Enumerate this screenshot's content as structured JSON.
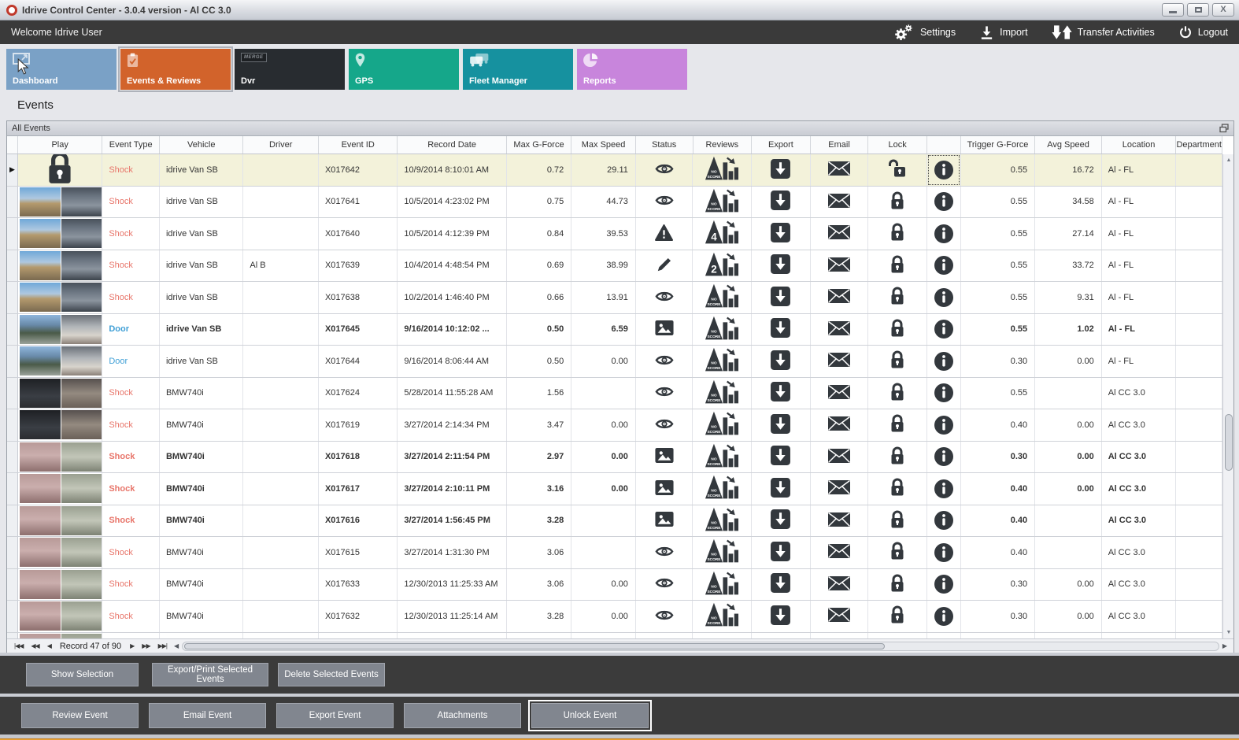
{
  "window": {
    "title": "Idrive Control Center - 3.0.4 version - Al CC 3.0",
    "controls": {
      "minimize": "minimize",
      "maximize": "maximize",
      "close": "close"
    }
  },
  "toolbar": {
    "welcome": "Welcome Idrive User",
    "settings_label": "Settings",
    "import_label": "Import",
    "transfer_label": "Transfer Activities",
    "logout_label": "Logout"
  },
  "nav_tiles": [
    {
      "label": "Dashboard",
      "color": "#7aa1c6",
      "icon": "monitor-icon",
      "selected": false
    },
    {
      "label": "Events & Reviews",
      "color": "#d2632b",
      "icon": "clipboard-check-icon",
      "selected": true
    },
    {
      "label": "Dvr",
      "color": "#282c30",
      "icon": "merge-badge-icon",
      "selected": false
    },
    {
      "label": "GPS",
      "color": "#15a78a",
      "icon": "location-pin-icon",
      "selected": false
    },
    {
      "label": "Fleet Manager",
      "color": "#16919f",
      "icon": "vehicles-icon",
      "selected": false
    },
    {
      "label": "Reports",
      "color": "#c885dc",
      "icon": "pie-chart-icon",
      "selected": false
    }
  ],
  "page": {
    "heading": "Events",
    "group_title": "All Events"
  },
  "table": {
    "columns": [
      "",
      "Play",
      "Event Type",
      "Vehicle",
      "Driver",
      "Event ID",
      "Record Date",
      "Max G-Force",
      "Max Speed",
      "Status",
      "Reviews",
      "Export",
      "Email",
      "Lock",
      "",
      "Trigger G-Force",
      "Avg Speed",
      "Location",
      "Department"
    ],
    "rows": [
      {
        "selected": true,
        "bold": false,
        "partial": false,
        "thumb": "lock",
        "event_type": "Shock",
        "vehicle": "idrive Van SB",
        "driver": "",
        "event_id": "X017642",
        "record_date": "10/9/2014 8:10:01 AM",
        "max_g": "0.72",
        "max_speed": "29.11",
        "status": "eye",
        "review": "NO SCORE",
        "lock": "unlocked",
        "trigger_g": "0.55",
        "avg_speed": "16.72",
        "location": "Al - FL",
        "department": ""
      },
      {
        "selected": false,
        "bold": false,
        "partial": false,
        "thumb": "van",
        "event_type": "Shock",
        "vehicle": "idrive Van SB",
        "driver": "",
        "event_id": "X017641",
        "record_date": "10/5/2014 4:23:02 PM",
        "max_g": "0.75",
        "max_speed": "44.73",
        "status": "eye",
        "review": "NO SCORE",
        "lock": "locked",
        "trigger_g": "0.55",
        "avg_speed": "34.58",
        "location": "Al - FL",
        "department": ""
      },
      {
        "selected": false,
        "bold": false,
        "partial": false,
        "thumb": "van",
        "event_type": "Shock",
        "vehicle": "idrive Van SB",
        "driver": "",
        "event_id": "X017640",
        "record_date": "10/5/2014 4:12:39 PM",
        "max_g": "0.84",
        "max_speed": "39.53",
        "status": "warning",
        "review": "4",
        "lock": "locked",
        "trigger_g": "0.55",
        "avg_speed": "27.14",
        "location": "Al - FL",
        "department": ""
      },
      {
        "selected": false,
        "bold": false,
        "partial": false,
        "thumb": "van",
        "event_type": "Shock",
        "vehicle": "idrive Van SB",
        "driver": "Al B",
        "event_id": "X017639",
        "record_date": "10/4/2014 4:48:54 PM",
        "max_g": "0.69",
        "max_speed": "38.99",
        "status": "pencil",
        "review": "2",
        "lock": "locked",
        "trigger_g": "0.55",
        "avg_speed": "33.72",
        "location": "Al - FL",
        "department": ""
      },
      {
        "selected": false,
        "bold": false,
        "partial": false,
        "thumb": "van",
        "event_type": "Shock",
        "vehicle": "idrive Van SB",
        "driver": "",
        "event_id": "X017638",
        "record_date": "10/2/2014 1:46:40 PM",
        "max_g": "0.66",
        "max_speed": "13.91",
        "status": "eye",
        "review": "NO SCORE",
        "lock": "locked",
        "trigger_g": "0.55",
        "avg_speed": "9.31",
        "location": "Al - FL",
        "department": ""
      },
      {
        "selected": false,
        "bold": true,
        "partial": false,
        "thumb": "van2",
        "event_type": "Door",
        "vehicle": "idrive Van SB",
        "driver": "",
        "event_id": "X017645",
        "record_date": "9/16/2014 10:12:02 ...",
        "max_g": "0.50",
        "max_speed": "6.59",
        "status": "picture",
        "review": "NO SCORE",
        "lock": "locked",
        "trigger_g": "0.55",
        "avg_speed": "1.02",
        "location": "Al - FL",
        "department": ""
      },
      {
        "selected": false,
        "bold": false,
        "partial": false,
        "thumb": "van2",
        "event_type": "Door",
        "vehicle": "idrive Van SB",
        "driver": "",
        "event_id": "X017644",
        "record_date": "9/16/2014 8:06:44 AM",
        "max_g": "0.50",
        "max_speed": "0.00",
        "status": "eye",
        "review": "NO SCORE",
        "lock": "locked",
        "trigger_g": "0.30",
        "avg_speed": "0.00",
        "location": "Al - FL",
        "department": ""
      },
      {
        "selected": false,
        "bold": false,
        "partial": false,
        "thumb": "dark",
        "event_type": "Shock",
        "vehicle": "BMW740i",
        "driver": "",
        "event_id": "X017624",
        "record_date": "5/28/2014 11:55:28 AM",
        "max_g": "1.56",
        "max_speed": "",
        "status": "eye",
        "review": "NO SCORE",
        "lock": "locked",
        "trigger_g": "0.55",
        "avg_speed": "",
        "location": "Al CC 3.0",
        "department": ""
      },
      {
        "selected": false,
        "bold": false,
        "partial": false,
        "thumb": "dark",
        "event_type": "Shock",
        "vehicle": "BMW740i",
        "driver": "",
        "event_id": "X017619",
        "record_date": "3/27/2014 2:14:34 PM",
        "max_g": "3.47",
        "max_speed": "0.00",
        "status": "eye",
        "review": "NO SCORE",
        "lock": "locked",
        "trigger_g": "0.40",
        "avg_speed": "0.00",
        "location": "Al CC 3.0",
        "department": ""
      },
      {
        "selected": false,
        "bold": true,
        "partial": false,
        "thumb": "pink",
        "event_type": "Shock",
        "vehicle": "BMW740i",
        "driver": "",
        "event_id": "X017618",
        "record_date": "3/27/2014 2:11:54 PM",
        "max_g": "2.97",
        "max_speed": "0.00",
        "status": "picture",
        "review": "NO SCORE",
        "lock": "locked",
        "trigger_g": "0.30",
        "avg_speed": "0.00",
        "location": "Al CC 3.0",
        "department": ""
      },
      {
        "selected": false,
        "bold": true,
        "partial": false,
        "thumb": "pink",
        "event_type": "Shock",
        "vehicle": "BMW740i",
        "driver": "",
        "event_id": "X017617",
        "record_date": "3/27/2014 2:10:11 PM",
        "max_g": "3.16",
        "max_speed": "0.00",
        "status": "picture",
        "review": "NO SCORE",
        "lock": "locked",
        "trigger_g": "0.40",
        "avg_speed": "0.00",
        "location": "Al CC 3.0",
        "department": ""
      },
      {
        "selected": false,
        "bold": true,
        "partial": false,
        "thumb": "pink",
        "event_type": "Shock",
        "vehicle": "BMW740i",
        "driver": "",
        "event_id": "X017616",
        "record_date": "3/27/2014 1:56:45 PM",
        "max_g": "3.28",
        "max_speed": "",
        "status": "picture",
        "review": "NO SCORE",
        "lock": "locked",
        "trigger_g": "0.40",
        "avg_speed": "",
        "location": "Al CC 3.0",
        "department": ""
      },
      {
        "selected": false,
        "bold": false,
        "partial": false,
        "thumb": "pink",
        "event_type": "Shock",
        "vehicle": "BMW740i",
        "driver": "",
        "event_id": "X017615",
        "record_date": "3/27/2014 1:31:30 PM",
        "max_g": "3.06",
        "max_speed": "",
        "status": "eye",
        "review": "NO SCORE",
        "lock": "locked",
        "trigger_g": "0.40",
        "avg_speed": "",
        "location": "Al CC 3.0",
        "department": ""
      },
      {
        "selected": false,
        "bold": false,
        "partial": false,
        "thumb": "pink",
        "event_type": "Shock",
        "vehicle": "BMW740i",
        "driver": "",
        "event_id": "X017633",
        "record_date": "12/30/2013 11:25:33 AM",
        "max_g": "3.06",
        "max_speed": "0.00",
        "status": "eye",
        "review": "NO SCORE",
        "lock": "locked",
        "trigger_g": "0.30",
        "avg_speed": "0.00",
        "location": "Al CC 3.0",
        "department": ""
      },
      {
        "selected": false,
        "bold": false,
        "partial": false,
        "thumb": "pink",
        "event_type": "Shock",
        "vehicle": "BMW740i",
        "driver": "",
        "event_id": "X017632",
        "record_date": "12/30/2013 11:25:14 AM",
        "max_g": "3.28",
        "max_speed": "0.00",
        "status": "eye",
        "review": "NO SCORE",
        "lock": "locked",
        "trigger_g": "0.30",
        "avg_speed": "0.00",
        "location": "Al CC 3.0",
        "department": ""
      },
      {
        "selected": false,
        "bold": false,
        "partial": true,
        "thumb": "pink",
        "event_type": "",
        "vehicle": "",
        "driver": "",
        "event_id": "",
        "record_date": "",
        "max_g": "",
        "max_speed": "",
        "status": "",
        "review": "",
        "lock": "",
        "trigger_g": "",
        "avg_speed": "",
        "location": "",
        "department": ""
      }
    ]
  },
  "pager": {
    "record_text": "Record 47 of 90",
    "nav_first": "|◀◀",
    "nav_prev_page": "◀◀",
    "nav_prev": "◀",
    "nav_next": "▶",
    "nav_next_page": "▶▶",
    "nav_last": "▶▶|",
    "hscroll_left": "◀",
    "hscroll_right": "▶",
    "vscroll_up": "▲",
    "vscroll_down": "▼"
  },
  "buttons": {
    "selection": [
      "Show Selection",
      "Export/Print Selected Events",
      "Delete Selected Events"
    ],
    "event": [
      "Review Event",
      "Email Event",
      "Export Event",
      "Attachments",
      "Unlock Event"
    ],
    "focused_event_button": "Unlock Event"
  },
  "icons": {
    "settings": "double-gear",
    "import": "download-arrow-tray",
    "transfer": "down-up-arrows",
    "logout": "power-symbol",
    "status_eye": "eye",
    "status_warning": "warning-triangle",
    "status_pencil": "pencil",
    "status_picture": "picture",
    "review_badge_values": [
      "NO SCORE",
      "4",
      "2"
    ],
    "export": "download-box",
    "email": "envelope",
    "lock": "padlock-closed",
    "unlock": "padlock-open",
    "info": "info-circle",
    "play_locked": "large-padlock",
    "group_restore": "restore-window"
  },
  "colors": {
    "toolbar_dark": "#3a3a3a",
    "tile_selected_accent": "#d2632b",
    "shock_text": "#e8756a",
    "door_text": "#3f9fd6",
    "selected_row_bg": "#f3f2da",
    "bottom_strip_orange": "#e8a033",
    "icon_dark": "#33383d"
  }
}
